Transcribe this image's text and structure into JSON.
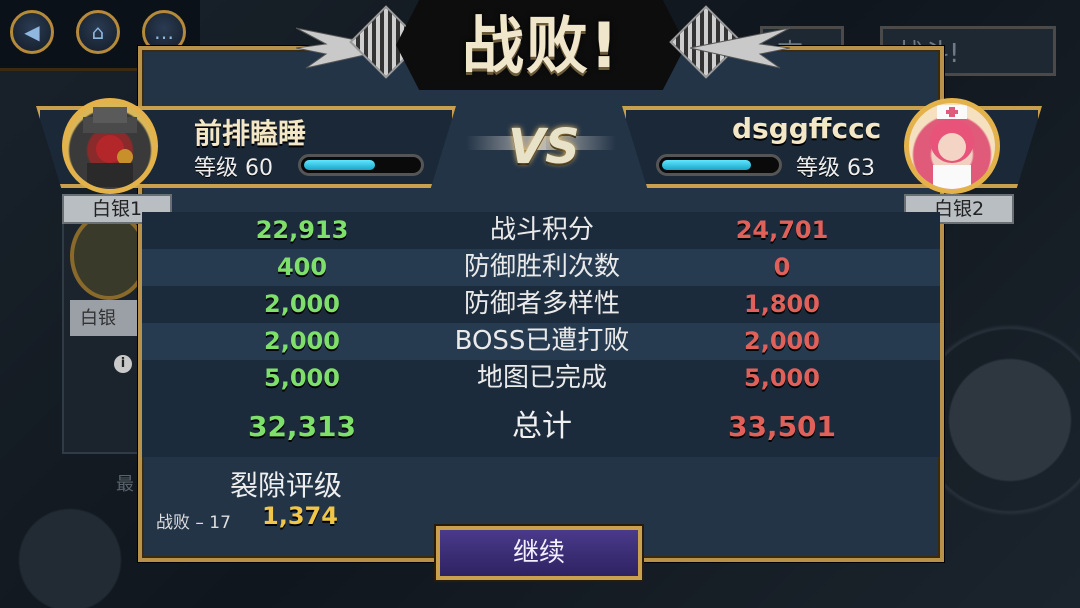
{
  "title": "战败!",
  "vs_label": "VS",
  "left_player": {
    "name": "前排瞌睡",
    "level_label": "等级",
    "level": "60",
    "xp_fraction": 0.62,
    "rank": "白银1"
  },
  "right_player": {
    "name": "dsggffccc",
    "level_label": "等级",
    "level": "63",
    "xp_fraction": 0.78,
    "rank": "白银2"
  },
  "stats": [
    {
      "label": "战斗积分",
      "left": "22,913",
      "right": "24,701"
    },
    {
      "label": "防御胜利次数",
      "left": "400",
      "right": "0"
    },
    {
      "label": "防御者多样性",
      "left": "2,000",
      "right": "1,800"
    },
    {
      "label": "BOSS已遭打败",
      "left": "2,000",
      "right": "2,000"
    },
    {
      "label": "地图已完成",
      "left": "5,000",
      "right": "5,000"
    }
  ],
  "total": {
    "label": "总计",
    "left": "32,313",
    "right": "33,501"
  },
  "rift": {
    "title": "裂隙评级",
    "result_label": "战败 – 17",
    "value": "1,374"
  },
  "continue_label": "继续",
  "background": {
    "tab_left": "查看",
    "tab_right": "战斗!",
    "rank_label": "白银",
    "side_text": "最"
  },
  "colors": {
    "win": "#7ee06b",
    "lose": "#e0605a",
    "gold": "#f0c648",
    "accent": "#c9a04e"
  }
}
